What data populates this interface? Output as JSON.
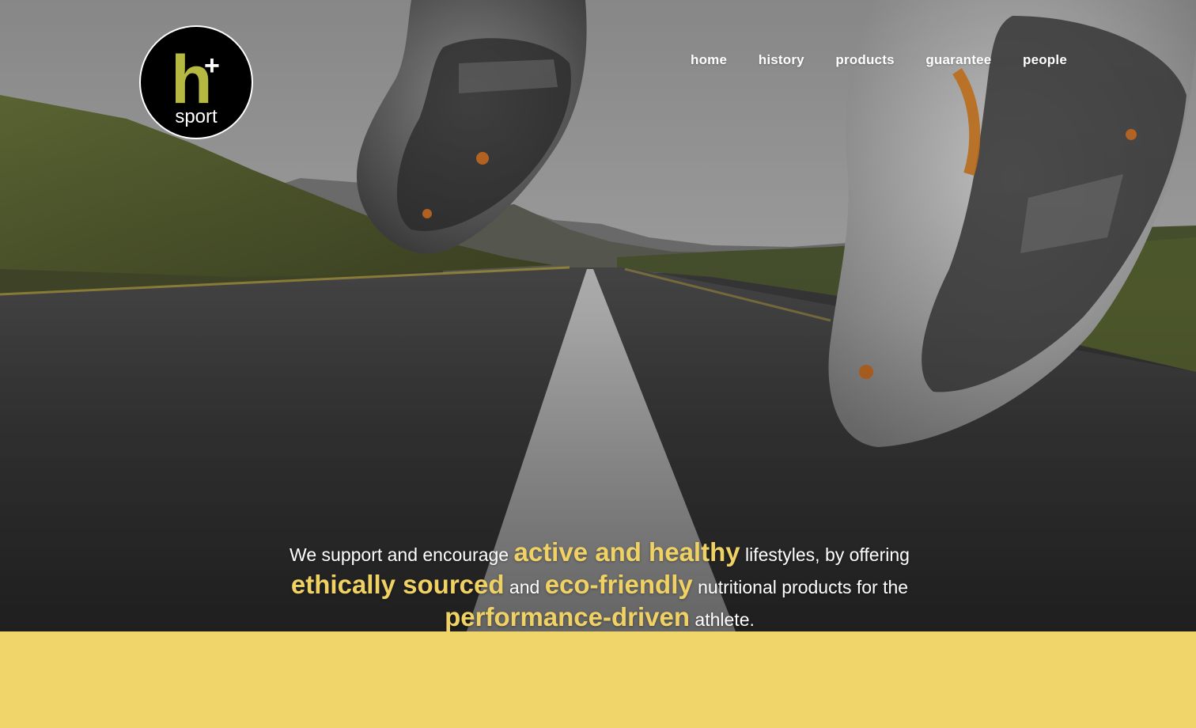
{
  "logo": {
    "mark": "h",
    "plus": "+",
    "word": "sport",
    "colors": {
      "circle": "#000000",
      "h": "#b5b942",
      "text": "#ffffff"
    }
  },
  "nav": {
    "items": [
      {
        "label": "home"
      },
      {
        "label": "history"
      },
      {
        "label": "products"
      },
      {
        "label": "guarantee"
      },
      {
        "label": "people"
      }
    ]
  },
  "hero": {
    "image": "running-shoes-on-road-photo",
    "mission": {
      "p1": "We support and encourage ",
      "h1": "active and healthy",
      "p2": " lifestyles, by offering ",
      "h2": "ethically sourced",
      "p3": " and ",
      "h3": "eco-friendly",
      "p4": " nutritional products for the ",
      "h4": "performance-driven",
      "p5": " athlete."
    }
  },
  "colors": {
    "accent": "#f0d264",
    "band": "#efd56a",
    "logo_green": "#b5b942"
  }
}
